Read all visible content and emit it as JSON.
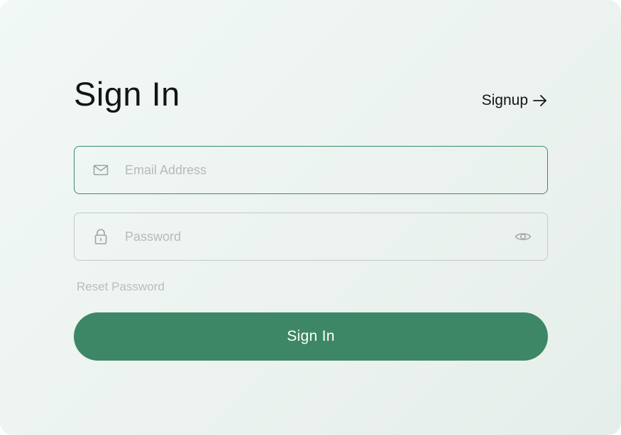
{
  "form": {
    "title": "Sign In",
    "signup_link": "Signup",
    "email": {
      "placeholder": "Email Address",
      "value": ""
    },
    "password": {
      "placeholder": "Password",
      "value": ""
    },
    "reset_link": "Reset Password",
    "submit_label": "Sign In"
  },
  "icons": {
    "signup": "arrow-right-icon",
    "email": "mail-icon",
    "password": "lock-icon",
    "visibility": "eye-icon"
  },
  "colors": {
    "accent": "#3d8766",
    "focus_border": "#3c8c69",
    "title_text": "#141414",
    "muted_text": "#b9bebc"
  }
}
